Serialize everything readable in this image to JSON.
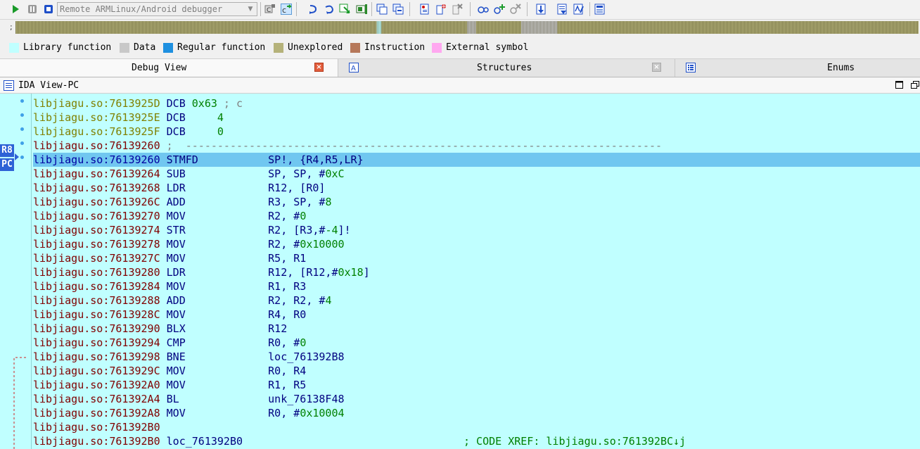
{
  "toolbar": {
    "debugger_select": "Remote ARMLinux/Android debugger",
    "buttons": [
      "start-icon",
      "pause-icon",
      "stop-icon",
      "attach-icon",
      "detach-icon",
      "step-into-icon",
      "step-over-icon",
      "run-to-cursor-icon",
      "step-out-icon",
      "windows-icon",
      "windows-alt-icon",
      "breakpoint-list-icon",
      "add-breakpoint-icon",
      "remove-breakpoint-icon",
      "tracing-icon",
      "add-trace-icon",
      "remove-trace-icon",
      "down-arrow-icon",
      "function-list-icon",
      "sort-icon",
      "stack-icon"
    ]
  },
  "navigator": {
    "lead": ";",
    "segments": [
      {
        "kind": "unexplored",
        "from": 0.0,
        "to": 0.4
      },
      {
        "kind": "library",
        "from": 0.4,
        "to": 0.405
      },
      {
        "kind": "unexplored",
        "from": 0.405,
        "to": 0.5
      },
      {
        "kind": "data",
        "from": 0.5,
        "to": 0.51
      },
      {
        "kind": "unexplored",
        "from": 0.51,
        "to": 0.56
      },
      {
        "kind": "data",
        "from": 0.56,
        "to": 0.6
      },
      {
        "kind": "unexplored",
        "from": 0.6,
        "to": 1.0
      }
    ]
  },
  "legend": [
    {
      "label": "Library function",
      "color": "#c0ffff"
    },
    {
      "label": "Data",
      "color": "#c8c8c8"
    },
    {
      "label": "Regular function",
      "color": "#1e90e0"
    },
    {
      "label": "Unexplored",
      "color": "#b5b27a"
    },
    {
      "label": "Instruction",
      "color": "#b6785a"
    },
    {
      "label": "External symbol",
      "color": "#ffa8f0"
    }
  ],
  "tabs": [
    {
      "label": "Debug View",
      "close": "×"
    },
    {
      "label": "Structures",
      "close": "×"
    },
    {
      "label": "Enums"
    }
  ],
  "view": {
    "title": "IDA View-PC",
    "pc_labels": [
      "R8",
      "PC"
    ]
  },
  "listing": [
    {
      "addr": "libjiagu.so:7613925D",
      "mn": "DCB",
      "ops": [
        {
          "t": "0x63",
          "c": "num"
        },
        {
          "t": " ; c",
          "c": "cmt"
        }
      ],
      "kind": "data"
    },
    {
      "addr": "libjiagu.so:7613925E",
      "mn": "DCB",
      "ops": [
        {
          "t": "    4",
          "c": "num"
        }
      ],
      "kind": "data"
    },
    {
      "addr": "libjiagu.so:7613925F",
      "mn": "DCB",
      "ops": [
        {
          "t": "    0",
          "c": "num"
        }
      ],
      "kind": "data"
    },
    {
      "addr": "libjiagu.so:76139260",
      "mn": "",
      "ops": [
        {
          "t": ";  ---------------------------------------------------------------------------",
          "c": "cmt"
        }
      ],
      "kind": "code"
    },
    {
      "addr": "libjiagu.so:76139260",
      "mn": "STMFD",
      "ops": [
        {
          "t": "SP!, {R4,R5,LR}",
          "c": "op"
        }
      ],
      "kind": "sel"
    },
    {
      "addr": "libjiagu.so:76139264",
      "mn": "SUB",
      "ops": [
        {
          "t": "SP, SP, #",
          "c": "op"
        },
        {
          "t": "0xC",
          "c": "num"
        }
      ],
      "kind": "code"
    },
    {
      "addr": "libjiagu.so:76139268",
      "mn": "LDR",
      "ops": [
        {
          "t": "R12, [R0]",
          "c": "op"
        }
      ],
      "kind": "code"
    },
    {
      "addr": "libjiagu.so:7613926C",
      "mn": "ADD",
      "ops": [
        {
          "t": "R3, SP, #",
          "c": "op"
        },
        {
          "t": "8",
          "c": "num"
        }
      ],
      "kind": "code"
    },
    {
      "addr": "libjiagu.so:76139270",
      "mn": "MOV",
      "ops": [
        {
          "t": "R2, #",
          "c": "op"
        },
        {
          "t": "0",
          "c": "num"
        }
      ],
      "kind": "code"
    },
    {
      "addr": "libjiagu.so:76139274",
      "mn": "STR",
      "ops": [
        {
          "t": "R2, [R3,#",
          "c": "op"
        },
        {
          "t": "-4",
          "c": "num"
        },
        {
          "t": "]!",
          "c": "op"
        }
      ],
      "kind": "code"
    },
    {
      "addr": "libjiagu.so:76139278",
      "mn": "MOV",
      "ops": [
        {
          "t": "R2, #",
          "c": "op"
        },
        {
          "t": "0x10000",
          "c": "num"
        }
      ],
      "kind": "code"
    },
    {
      "addr": "libjiagu.so:7613927C",
      "mn": "MOV",
      "ops": [
        {
          "t": "R5, R1",
          "c": "op"
        }
      ],
      "kind": "code"
    },
    {
      "addr": "libjiagu.so:76139280",
      "mn": "LDR",
      "ops": [
        {
          "t": "R12, [R12,#",
          "c": "op"
        },
        {
          "t": "0x18",
          "c": "num"
        },
        {
          "t": "]",
          "c": "op"
        }
      ],
      "kind": "code"
    },
    {
      "addr": "libjiagu.so:76139284",
      "mn": "MOV",
      "ops": [
        {
          "t": "R1, R3",
          "c": "op"
        }
      ],
      "kind": "code"
    },
    {
      "addr": "libjiagu.so:76139288",
      "mn": "ADD",
      "ops": [
        {
          "t": "R2, R2, #",
          "c": "op"
        },
        {
          "t": "4",
          "c": "num"
        }
      ],
      "kind": "code"
    },
    {
      "addr": "libjiagu.so:7613928C",
      "mn": "MOV",
      "ops": [
        {
          "t": "R4, R0",
          "c": "op"
        }
      ],
      "kind": "code"
    },
    {
      "addr": "libjiagu.so:76139290",
      "mn": "BLX",
      "ops": [
        {
          "t": "R12",
          "c": "op"
        }
      ],
      "kind": "code"
    },
    {
      "addr": "libjiagu.so:76139294",
      "mn": "CMP",
      "ops": [
        {
          "t": "R0, #",
          "c": "op"
        },
        {
          "t": "0",
          "c": "num"
        }
      ],
      "kind": "code"
    },
    {
      "addr": "libjiagu.so:76139298",
      "mn": "BNE",
      "ops": [
        {
          "t": "loc_761392B8",
          "c": "op"
        }
      ],
      "kind": "code"
    },
    {
      "addr": "libjiagu.so:7613929C",
      "mn": "MOV",
      "ops": [
        {
          "t": "R0, R4",
          "c": "op"
        }
      ],
      "kind": "code"
    },
    {
      "addr": "libjiagu.so:761392A0",
      "mn": "MOV",
      "ops": [
        {
          "t": "R1, R5",
          "c": "op"
        }
      ],
      "kind": "code"
    },
    {
      "addr": "libjiagu.so:761392A4",
      "mn": "BL",
      "ops": [
        {
          "t": "unk_76138F48",
          "c": "op"
        }
      ],
      "kind": "code"
    },
    {
      "addr": "libjiagu.so:761392A8",
      "mn": "MOV",
      "ops": [
        {
          "t": "R0, #",
          "c": "op"
        },
        {
          "t": "0x10004",
          "c": "num"
        }
      ],
      "kind": "code"
    },
    {
      "addr": "libjiagu.so:761392B0",
      "mn": "",
      "ops": [],
      "kind": "code"
    },
    {
      "addr": "libjiagu.so:761392B0",
      "mn": "loc_761392B0",
      "ops": [],
      "xref": "; CODE XREF: libjiagu.so:761392BC↓j",
      "kind": "code"
    }
  ]
}
